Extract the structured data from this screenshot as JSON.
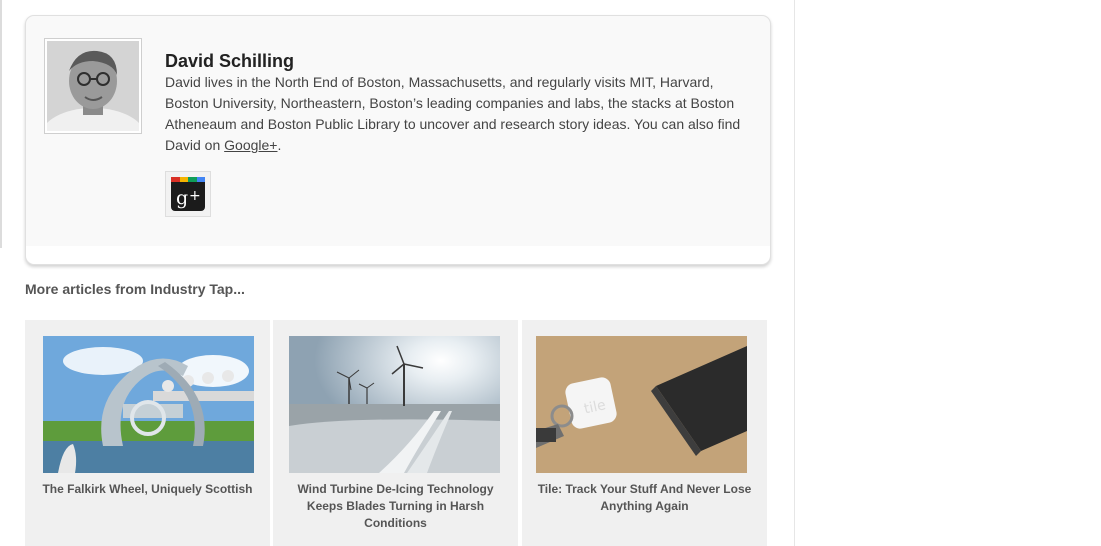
{
  "author": {
    "name": "David Schilling",
    "bio": "David lives in the North End of Boston, Massachusetts, and regularly visits MIT, Harvard, Boston University, Northeastern, Boston’s leading companies and labs, the stacks at Boston Atheneaum and Boston Public Library to uncover and research story ideas. You can also find David on ",
    "bio_link": "Google+",
    "bio_end": ".",
    "social_icon": "google-plus-icon"
  },
  "more": {
    "heading": "More articles from Industry Tap..."
  },
  "articles": [
    {
      "title": "The Falkirk Wheel, Uniquely Scottish"
    },
    {
      "title": "Wind Turbine De-Icing Technology Keeps Blades Turning in Harsh Conditions"
    },
    {
      "title": "Tile: Track Your Stuff And Never Lose Anything Again"
    }
  ]
}
